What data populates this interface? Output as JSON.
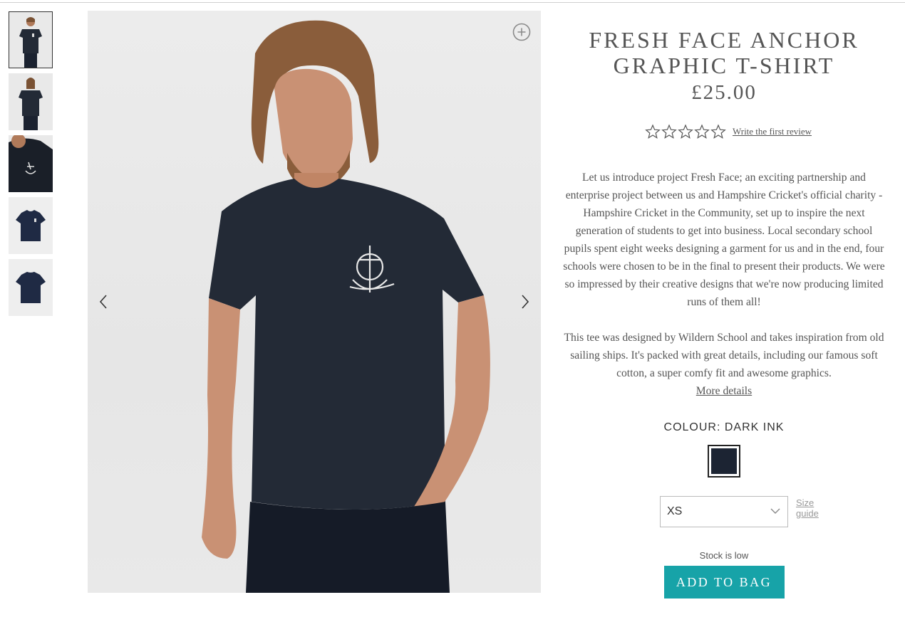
{
  "product": {
    "title": "FRESH FACE ANCHOR GRAPHIC T-SHIRT",
    "price": "£25.00",
    "rating": {
      "value": 0,
      "max": 5
    },
    "review_link": "Write the first review",
    "description": [
      "Let us introduce project Fresh Face; an exciting partnership and enterprise project between us and Hampshire Cricket's official charity - Hampshire Cricket in the Community, set up to inspire the next generation of students to get into business. Local secondary school pupils spent eight weeks designing a garment for us and in the end, four schools were chosen to be in the final to present their products. We were so impressed by their creative designs that we're now producing limited runs of them all!",
      "This tee was designed by Wildern School and takes inspiration from old sailing ships. It's packed with great details, including our famous soft cotton, a super comfy fit and awesome graphics."
    ],
    "more_details": "More details",
    "colour_label": "COLOUR: DARK INK",
    "swatch_color": "#1c2433",
    "size": {
      "selected": "XS"
    },
    "size_guide": "Size guide",
    "stock_text": "Stock is low",
    "add_to_bag": "ADD TO BAG"
  },
  "gallery": {
    "thumbnails": [
      {
        "view": "model-front",
        "active": true
      },
      {
        "view": "model-back",
        "active": false
      },
      {
        "view": "graphic-closeup",
        "active": false
      },
      {
        "view": "flat-front",
        "active": false
      },
      {
        "view": "flat-back",
        "active": false
      }
    ],
    "icons": {
      "zoom": "zoom-in-icon",
      "prev": "chevron-left-icon",
      "next": "chevron-right-icon"
    }
  },
  "colors": {
    "accent": "#17a3a8",
    "shirt": "#232a36",
    "text": "#555555"
  }
}
